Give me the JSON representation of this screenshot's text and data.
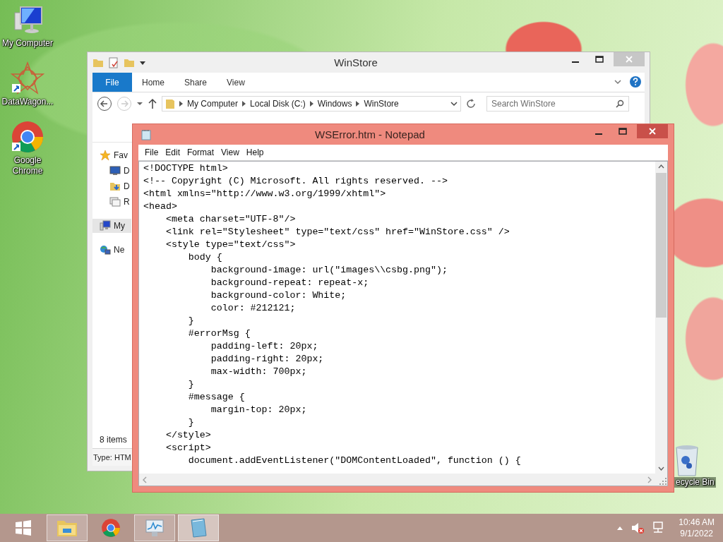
{
  "desktop_icons": [
    {
      "label": "My Computer",
      "kind": "computer"
    },
    {
      "label": "DataWagon...",
      "kind": "datawagon"
    },
    {
      "label": "Google Chrome",
      "kind": "chrome"
    }
  ],
  "recycle_bin": {
    "label": "ecycle Bin"
  },
  "explorer": {
    "title": "WinStore",
    "file_tab": "File",
    "tabs": [
      "Home",
      "Share",
      "View"
    ],
    "breadcrumb": [
      "My Computer",
      "Local Disk (C:)",
      "Windows",
      "WinStore"
    ],
    "search": {
      "placeholder": "Search WinStore"
    },
    "nav": [
      {
        "label": "Fav",
        "kind": "favorites",
        "selected": false,
        "children": [
          {
            "label": "D",
            "kind": "desktop",
            "selected": false
          },
          {
            "label": "D",
            "kind": "downloads",
            "selected": false
          },
          {
            "label": "R",
            "kind": "recent",
            "selected": false
          }
        ]
      },
      {
        "label": "My",
        "kind": "computer",
        "selected": true
      },
      {
        "label": "Ne",
        "kind": "network",
        "selected": false
      }
    ],
    "status": "8 items",
    "details": "Type: HTM"
  },
  "notepad": {
    "title": "WSError.htm - Notepad",
    "menu": [
      "File",
      "Edit",
      "Format",
      "View",
      "Help"
    ],
    "lines": [
      "<!DOCTYPE html>",
      "<!-- Copyright (C) Microsoft. All rights reserved. -->",
      "<html xmlns=\"http://www.w3.org/1999/xhtml\">",
      "<head>",
      "    <meta charset=\"UTF-8\"/>",
      "    <link rel=\"Stylesheet\" type=\"text/css\" href=\"WinStore.css\" />",
      "    <style type=\"text/css\">",
      "        body {",
      "            background-image: url(\"images\\\\csbg.png\");",
      "            background-repeat: repeat-x;",
      "            background-color: White;",
      "            color: #212121;",
      "        }",
      "        #errorMsg {",
      "            padding-left: 20px;",
      "            padding-right: 20px;",
      "            max-width: 700px;",
      "        }",
      "        #message {",
      "            margin-top: 20px;",
      "        }",
      "    </style>",
      "    <script>",
      "        document.addEventListener(\"DOMContentLoaded\", function () {"
    ]
  },
  "taskbar": {
    "items": [
      {
        "kind": "explorer",
        "running": true,
        "selected": false
      },
      {
        "kind": "chrome",
        "running": false,
        "selected": false
      },
      {
        "kind": "monitor",
        "running": true,
        "selected": false
      },
      {
        "kind": "notepad",
        "running": true,
        "selected": true
      }
    ],
    "volume_muted": true,
    "time": "10:46 AM",
    "date": "9/1/2022"
  }
}
